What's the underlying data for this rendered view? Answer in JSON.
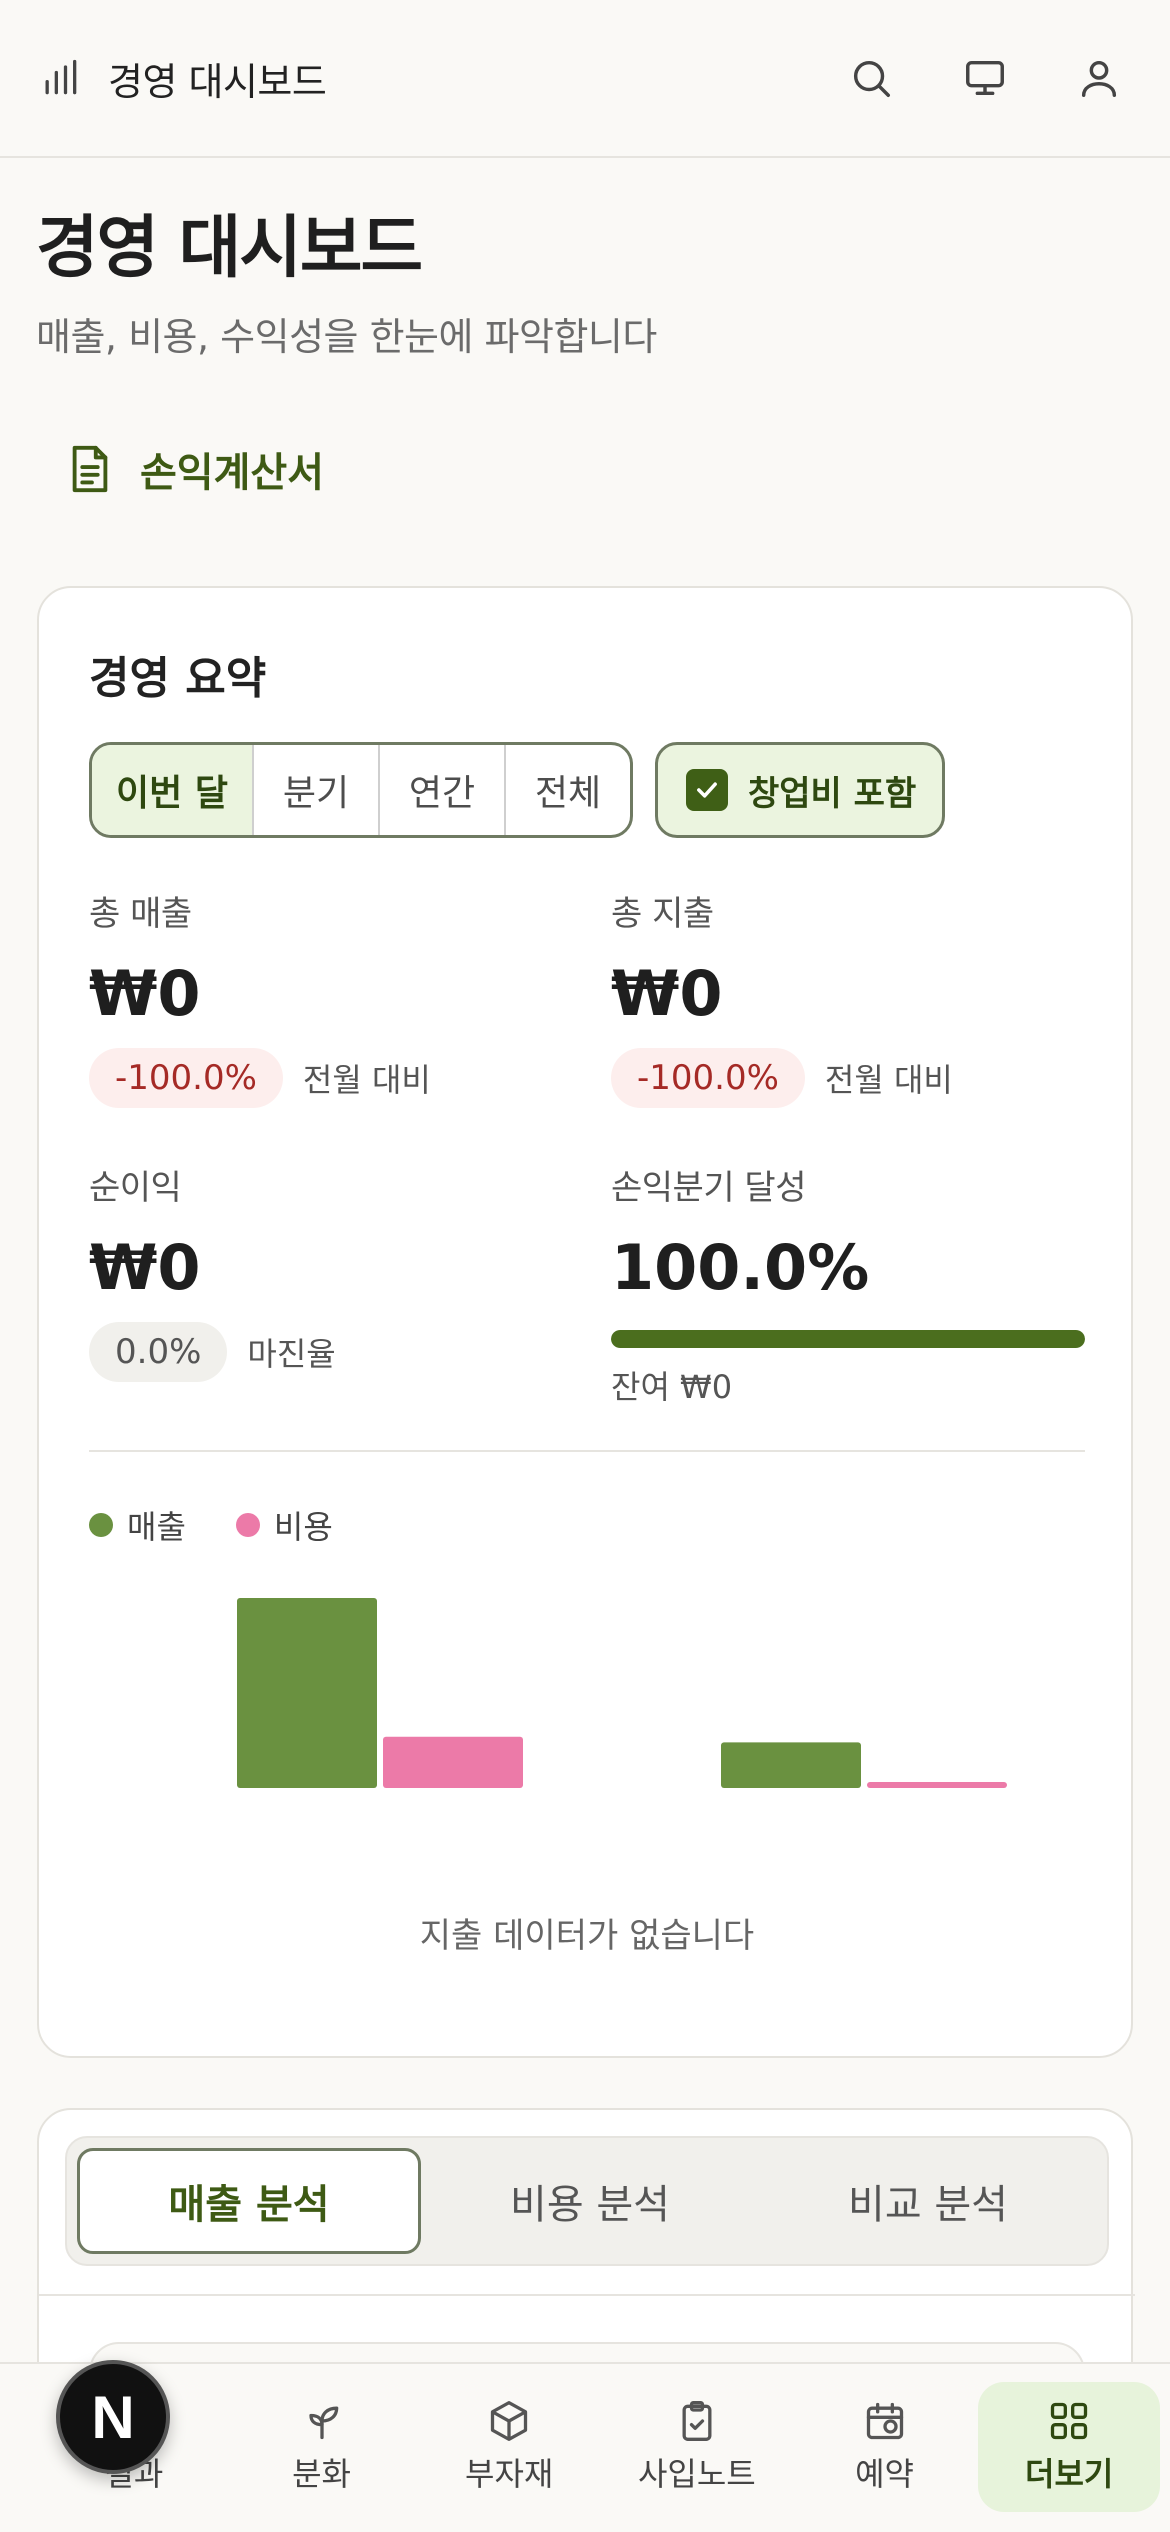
{
  "header": {
    "title": "경영 대시보드"
  },
  "page": {
    "title": "경영 대시보드",
    "subtitle": "매출, 비용, 수익성을 한눈에 파악합니다",
    "pl_link": "손익계산서"
  },
  "summary": {
    "title": "경영 요약",
    "periods": [
      "이번 달",
      "분기",
      "연간",
      "전체"
    ],
    "active_period": "이번 달",
    "include_startup_label": "창업비 포함",
    "include_startup_checked": true,
    "revenue": {
      "label": "총 매출",
      "value": "₩0",
      "change": "-100.0%",
      "change_note": "전월 대비"
    },
    "expense": {
      "label": "총 지출",
      "value": "₩0",
      "change": "-100.0%",
      "change_note": "전월 대비"
    },
    "net_income": {
      "label": "순이익",
      "value": "₩0",
      "margin": "0.0%",
      "margin_note": "마진율"
    },
    "breakeven": {
      "label": "손익분기 달성",
      "value": "100.0%",
      "progress": 1.0,
      "remaining": "잔여 ₩0"
    },
    "legend": {
      "revenue": "매출",
      "expense": "비용"
    },
    "empty_note": "지출 데이터가 없습니다"
  },
  "chart_data": {
    "type": "bar",
    "categories": [
      "",
      ""
    ],
    "series": [
      {
        "name": "매출",
        "color": "#6a9140",
        "values": [
          100,
          24
        ]
      },
      {
        "name": "비용",
        "color": "#ec7aa8",
        "values": [
          27,
          3
        ]
      }
    ],
    "ylim": [
      0,
      100
    ],
    "grid": false,
    "legend": "top-left"
  },
  "analysis": {
    "tabs": [
      "매출 분석",
      "비용 분석",
      "비교 분석"
    ],
    "active_tab": "매출 분석"
  },
  "nav": {
    "items": [
      {
        "label": "결과",
        "icon": "circle-n-icon"
      },
      {
        "label": "분화",
        "icon": "sprout-icon"
      },
      {
        "label": "부자재",
        "icon": "box-icon"
      },
      {
        "label": "사입노트",
        "icon": "clipboard-check-icon"
      },
      {
        "label": "예약",
        "icon": "calendar-icon"
      },
      {
        "label": "더보기",
        "icon": "grid-icon"
      }
    ],
    "active": "더보기",
    "fab_letter": "N"
  }
}
